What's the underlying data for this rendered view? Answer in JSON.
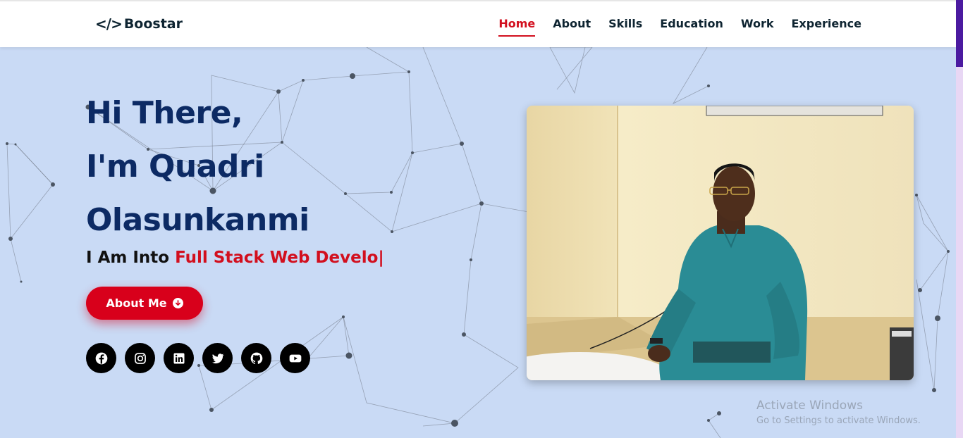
{
  "brand": {
    "name": "Boostar",
    "icon": "code-icon"
  },
  "nav": {
    "items": [
      {
        "label": "Home",
        "active": true
      },
      {
        "label": "About",
        "active": false
      },
      {
        "label": "Skills",
        "active": false
      },
      {
        "label": "Education",
        "active": false
      },
      {
        "label": "Work",
        "active": false
      },
      {
        "label": "Experience",
        "active": false
      }
    ]
  },
  "hero": {
    "line1": "Hi There,",
    "line2": "I'm Quadri",
    "line3": "Olasunkanmi",
    "typed_prefix": "I Am Into ",
    "typed_text": "Full Stack Web Develo|",
    "button_label": "About Me",
    "button_icon": "arrow-down-circle-icon",
    "socials": [
      "facebook-icon",
      "instagram-icon",
      "linkedin-icon",
      "twitter-icon",
      "github-icon",
      "youtube-icon"
    ]
  },
  "watermark": {
    "title": "Activate Windows",
    "subtitle": "Go to Settings to activate Windows."
  },
  "colors": {
    "accent": "#d20f1e",
    "heading": "#0c2a64",
    "background": "#c9daf5",
    "scroll_thumb": "#4b1aa0"
  }
}
